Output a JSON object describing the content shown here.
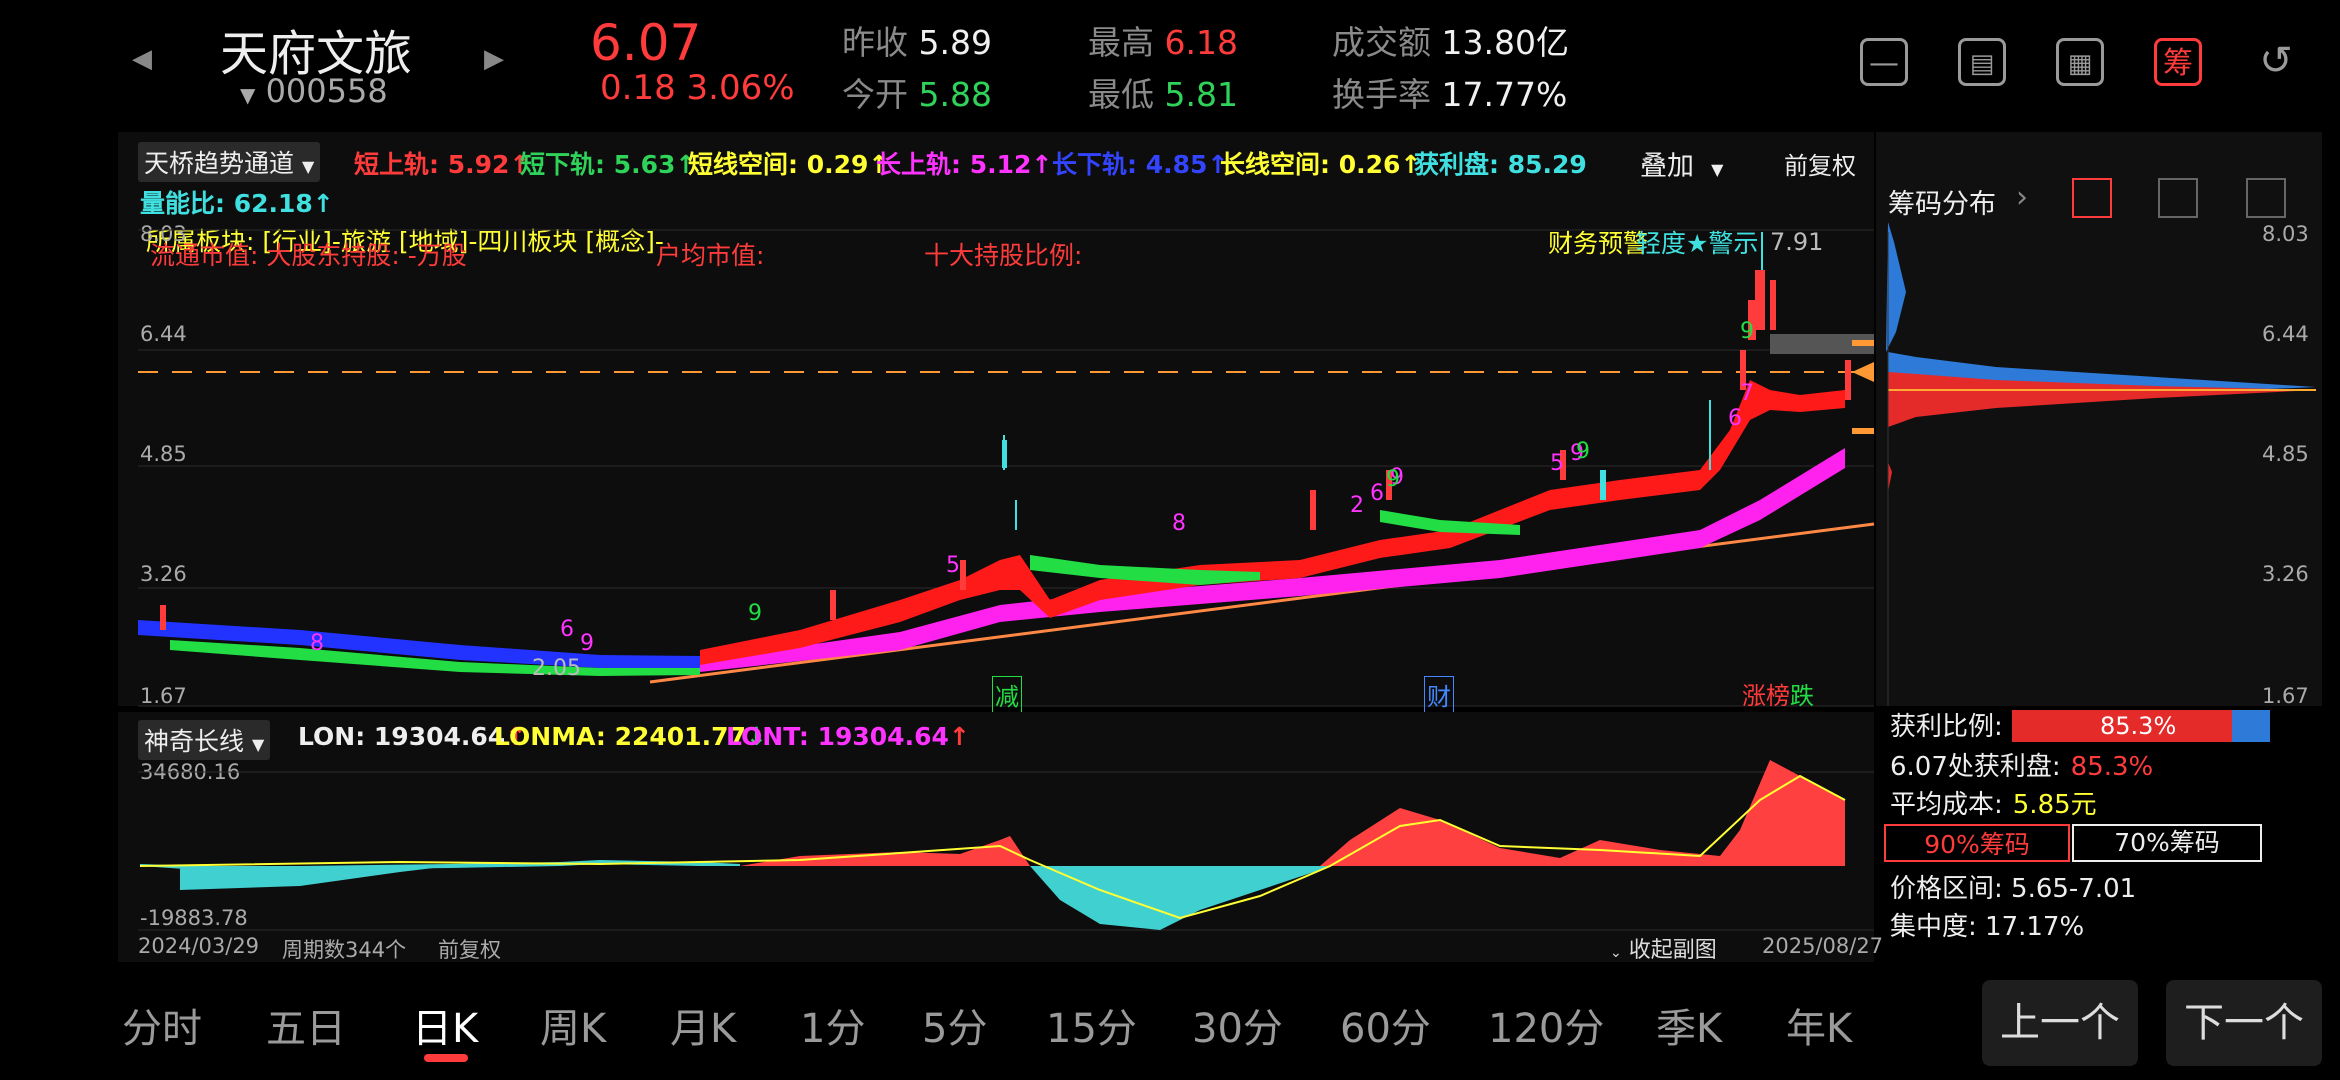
{
  "header": {
    "stock_name": "天府文旅",
    "stock_code": "000558",
    "price": "6.07",
    "change": "0.18",
    "change_pct": "3.06%",
    "prev_close_label": "昨收",
    "prev_close": "5.89",
    "open_label": "今开",
    "open": "5.88",
    "high_label": "最高",
    "high": "6.18",
    "low_label": "最低",
    "low": "5.81",
    "turnover_label": "成交额",
    "turnover": "13.80亿",
    "turnover_rate_label": "换手率",
    "turnover_rate": "17.77%",
    "btn_chou": "筹"
  },
  "indicator_main": {
    "name": "天桥趋势通道",
    "short_upper": "短上轨: 5.92",
    "short_lower": "短下轨: 5.63",
    "short_space": "短线空间: 0.29",
    "long_upper": "长上轨: 5.12",
    "long_lower": "长下轨: 4.85",
    "long_space": "长线空间: 0.26",
    "profit": "获利盘: 85.29",
    "volume_ratio": "量能比: 62.18",
    "overlay": "叠加",
    "adjust": "前复权",
    "sector": "所属板块: [行业]-旅游 [地域]-四川板块 [概念]-",
    "float_cap": "流通市值: 大股东持股: -万股",
    "avg_cap": "户均市值:",
    "top10": "十大持股比例:",
    "warning": "财务预警",
    "warning2": "轻度★警示",
    "peak_label": "7.91",
    "low_label": "2.05",
    "mark_jian": "减",
    "mark_cai": "财",
    "mark_zhang": "涨",
    "mark_bang": "榜",
    "mark_die": "跌",
    "y_labels": [
      "8.03",
      "6.44",
      "4.85",
      "3.26",
      "1.67"
    ]
  },
  "chip": {
    "title": "筹码分布",
    "y_labels": [
      "8.03",
      "6.44",
      "4.85",
      "3.26",
      "1.67"
    ],
    "profit_ratio_label": "获利比例:",
    "profit_ratio": "85.3%",
    "profit_at_label": "6.07处获利盘:",
    "profit_at": "85.3%",
    "avg_cost_label": "平均成本:",
    "avg_cost": "5.85元",
    "chip90": "90%筹码",
    "chip70": "70%筹码",
    "price_range": "价格区间: 5.65-7.01",
    "concentration": "集中度: 17.17%"
  },
  "indicator_sub": {
    "name": "神奇长线",
    "lon": "LON: 19304.64",
    "lonma": "LONMA: 22401.77",
    "lont": "LONT: 19304.64",
    "y_max": "34680.16",
    "y_min": "-19883.78"
  },
  "footer": {
    "start_date": "2024/03/29",
    "period_count": "周期数344个",
    "adjust": "前复权",
    "collapse": "收起副图",
    "end_date": "2025/08/27"
  },
  "tabs": [
    "分时",
    "五日",
    "日K",
    "周K",
    "月K",
    "1分",
    "5分",
    "15分",
    "30分",
    "60分",
    "120分",
    "季K",
    "年K"
  ],
  "active_tab": "日K",
  "nav": {
    "prev": "上一个",
    "next": "下一个"
  },
  "colors": {
    "up": "#ff3b3b",
    "down": "#2fd35a",
    "cyan": "#40e0e0",
    "magenta": "#ff33ff",
    "yellow": "#ffff33",
    "blue": "#3344ff",
    "orange": "#ff9933"
  }
}
